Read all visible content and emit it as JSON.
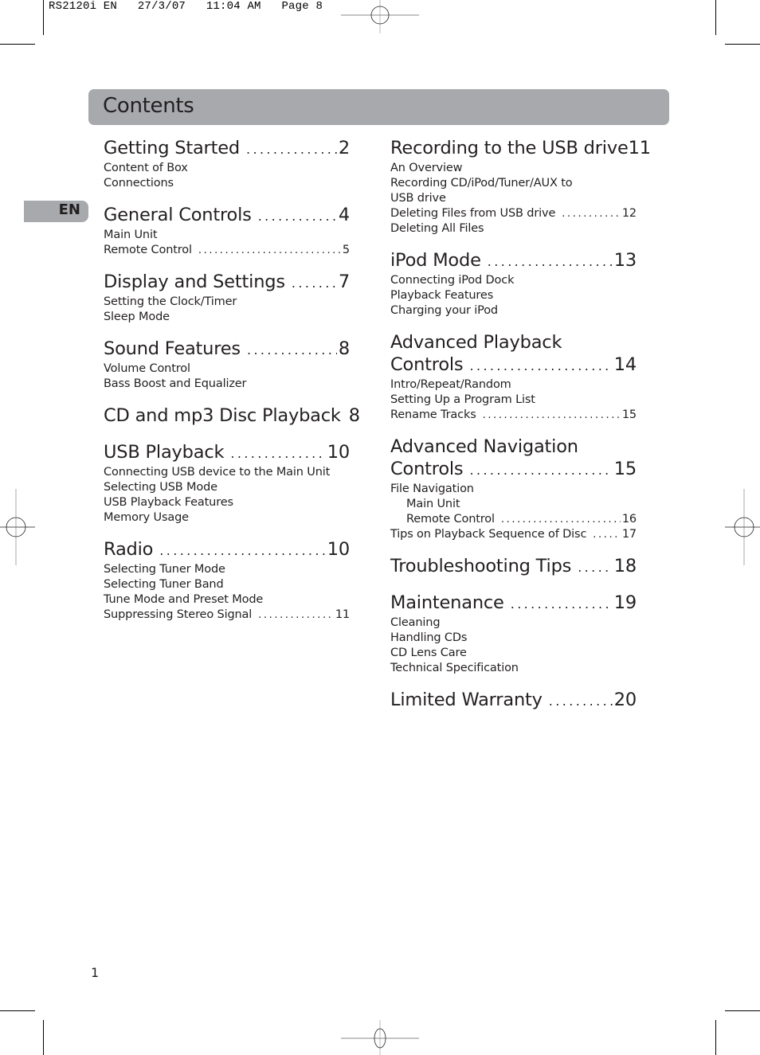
{
  "slug": "RS2120i EN   27/3/07   11:04 AM   Page 8",
  "header": {
    "title": "Contents"
  },
  "language_tab": "EN",
  "page_number": "1",
  "left_column": [
    {
      "title": "Getting Started",
      "page": "2",
      "items": [
        {
          "label": "Content of Box"
        },
        {
          "label": "Connections"
        }
      ]
    },
    {
      "title": "General Controls",
      "page": "4",
      "items": [
        {
          "label": "Main Unit"
        },
        {
          "label": "Remote Control",
          "page": "5"
        }
      ]
    },
    {
      "title": "Display and Settings",
      "page": "7",
      "items": [
        {
          "label": "Setting the Clock/Timer"
        },
        {
          "label": "Sleep Mode"
        }
      ]
    },
    {
      "title": "Sound Features",
      "page": "8",
      "items": [
        {
          "label": "Volume Control"
        },
        {
          "label": "Bass Boost and Equalizer"
        }
      ]
    },
    {
      "title": "CD and mp3 Disc Playback",
      "page": "8",
      "items": []
    },
    {
      "title": "USB Playback",
      "page": "10",
      "items": [
        {
          "label": "Connecting USB device to the Main Unit"
        },
        {
          "label": "Selecting USB Mode"
        },
        {
          "label": "USB Playback Features"
        },
        {
          "label": "Memory Usage"
        }
      ]
    },
    {
      "title": "Radio",
      "page": "10",
      "items": [
        {
          "label": "Selecting Tuner Mode"
        },
        {
          "label": "Selecting Tuner Band"
        },
        {
          "label": "Tune Mode and Preset Mode"
        },
        {
          "label": "Suppressing Stereo Signal",
          "page": "11"
        }
      ]
    }
  ],
  "right_column": [
    {
      "title": "Recording to the USB drive",
      "page": "11",
      "items": [
        {
          "label": "An Overview"
        },
        {
          "label": "Recording CD/iPod/Tuner/AUX to"
        },
        {
          "label": "USB drive"
        },
        {
          "label": "Deleting Files from USB drive",
          "page": "12"
        },
        {
          "label": "Deleting All Files"
        }
      ]
    },
    {
      "title": "iPod Mode",
      "page": "13",
      "items": [
        {
          "label": "Connecting iPod Dock"
        },
        {
          "label": "Playback Features"
        },
        {
          "label": "Charging your iPod"
        }
      ]
    },
    {
      "title_line1": "Advanced Playback",
      "title": "Controls",
      "page": "14",
      "items": [
        {
          "label": "Intro/Repeat/Random"
        },
        {
          "label": "Setting Up a Program List"
        },
        {
          "label": "Rename Tracks",
          "page": "15"
        }
      ]
    },
    {
      "title_line1": "Advanced Navigation",
      "title": "Controls",
      "page": "15",
      "items": [
        {
          "label": "File Navigation"
        },
        {
          "label": "Main Unit",
          "indent": true
        },
        {
          "label": "Remote Control",
          "page": "16",
          "indent": true
        },
        {
          "label": "Tips on Playback Sequence of Disc",
          "page": "17"
        }
      ]
    },
    {
      "title": "Troubleshooting Tips",
      "page": "18",
      "items": []
    },
    {
      "title": "Maintenance",
      "page": "19",
      "items": [
        {
          "label": "Cleaning"
        },
        {
          "label": "Handling CDs"
        },
        {
          "label": "CD Lens Care"
        },
        {
          "label": "Technical Specification"
        }
      ]
    },
    {
      "title": "Limited Warranty",
      "page": "20",
      "items": []
    }
  ]
}
